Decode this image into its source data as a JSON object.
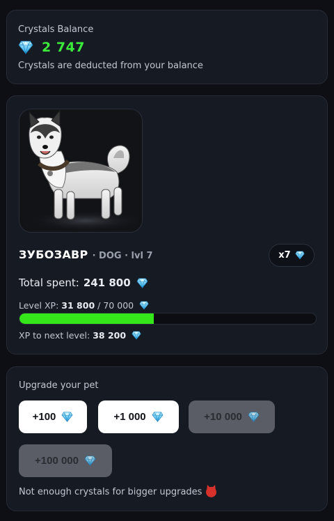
{
  "balance": {
    "label": "Crystals Balance",
    "value": "2 747",
    "note": "Crystals are deducted from your balance"
  },
  "pet": {
    "image_icon": "husky-dog-image",
    "name": "ЗУБОЗАВР",
    "meta": "· DOG · lvl 7",
    "multiplier": "x7",
    "total_spent_label": "Total spent:",
    "total_spent_value": "241 800",
    "xp_label": "Level XP:",
    "xp_current": "31 800",
    "xp_sep": "/",
    "xp_max": "70 000",
    "xp_progress_fraction": 0.454,
    "next_label": "XP to next level:",
    "next_value": "38 200"
  },
  "upgrade": {
    "title": "Upgrade your pet",
    "buttons": [
      {
        "label": "+100",
        "enabled": true
      },
      {
        "label": "+1 000",
        "enabled": true
      },
      {
        "label": "+10 000",
        "enabled": false
      },
      {
        "label": "+100 000",
        "enabled": false
      }
    ],
    "note": "Not enough crystals for bigger upgrades",
    "note_icon": "devil-face-icon"
  },
  "colors": {
    "accent_green": "#3bea3b",
    "xp_fill": "#35e61a",
    "gem": "#5fd0ff"
  }
}
